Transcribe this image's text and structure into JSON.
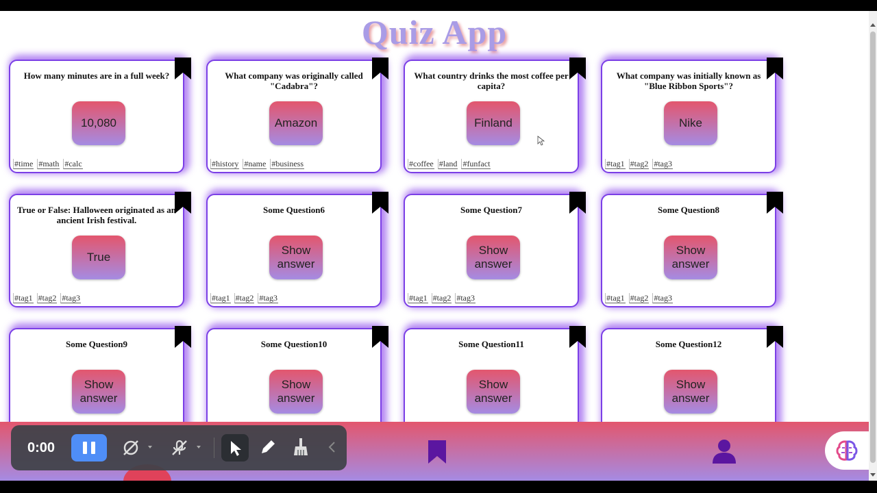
{
  "app": {
    "title": "Quiz App"
  },
  "cards": [
    {
      "question": "How many minutes are in a full week?",
      "answer": "10,080",
      "tags": [
        "#time",
        "#math",
        "#calc"
      ]
    },
    {
      "question": "What company was originally called \"Cadabra\"?",
      "answer": "Amazon",
      "tags": [
        "#history",
        "#name",
        "#business"
      ]
    },
    {
      "question": "What country drinks the most coffee per capita?",
      "answer": "Finland",
      "tags": [
        "#coffee",
        "#land",
        "#funfact"
      ]
    },
    {
      "question": "What company was initially known as \"Blue Ribbon Sports\"?",
      "answer": "Nike",
      "tags": [
        "#tag1",
        "#tag2",
        "#tag3"
      ]
    },
    {
      "question": "True or False: Halloween originated as an ancient Irish festival.",
      "answer": "True",
      "tags": [
        "#tag1",
        "#tag2",
        "#tag3"
      ]
    },
    {
      "question": "Some Question6",
      "answer": "Show answer",
      "tags": [
        "#tag1",
        "#tag2",
        "#tag3"
      ]
    },
    {
      "question": "Some Question7",
      "answer": "Show answer",
      "tags": [
        "#tag1",
        "#tag2",
        "#tag3"
      ]
    },
    {
      "question": "Some Question8",
      "answer": "Show answer",
      "tags": [
        "#tag1",
        "#tag2",
        "#tag3"
      ]
    },
    {
      "question": "Some Question9",
      "answer": "Show answer",
      "tags": []
    },
    {
      "question": "Some Question10",
      "answer": "Show answer",
      "tags": []
    },
    {
      "question": "Some Question11",
      "answer": "Show answer",
      "tags": []
    },
    {
      "question": "Some Question12",
      "answer": "Show answer",
      "tags": []
    }
  ],
  "bottom_nav": {
    "items": [
      {
        "icon": "home-icon"
      },
      {
        "icon": "bookmark-icon"
      },
      {
        "icon": "user-icon"
      }
    ],
    "assistant_icon": "brain-icon"
  },
  "recorder": {
    "time": "0:00",
    "controls": [
      "pause-icon",
      "camera-off-icon",
      "mic-off-icon",
      "pointer-icon",
      "pen-icon",
      "broom-icon",
      "collapse-icon"
    ]
  },
  "colors": {
    "card_border": "#7b3fe6",
    "button_gradient_top": "#e3566d",
    "button_gradient_bottom": "#a58be3",
    "nav_icon": "#5b16a0",
    "recorder_accent": "#4f8ef7"
  }
}
